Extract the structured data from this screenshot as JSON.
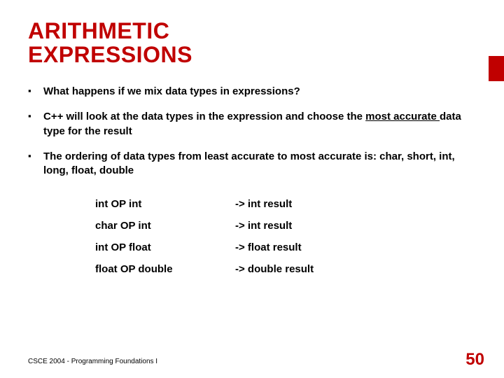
{
  "title_line1": "ARITHMETIC",
  "title_line2": "EXPRESSIONS",
  "bullets": [
    {
      "text": "What happens if we mix data types in expressions?"
    },
    {
      "pre": "C++ will look at the data types in the expression and choose the ",
      "u": "most accurate ",
      "post": "data type for the result"
    },
    {
      "text": "The ordering of data types from least accurate to most accurate is: char, short, int, long, float, double"
    }
  ],
  "table": [
    {
      "lhs": "int OP int",
      "rhs": "-> int result"
    },
    {
      "lhs": "char OP int",
      "rhs": "-> int result"
    },
    {
      "lhs": "int OP float",
      "rhs": "-> float result"
    },
    {
      "lhs": "float OP double",
      "rhs": "-> double result"
    }
  ],
  "footer": "CSCE 2004 - Programming Foundations I",
  "page_number": "50",
  "colors": {
    "accent": "#c00000"
  }
}
